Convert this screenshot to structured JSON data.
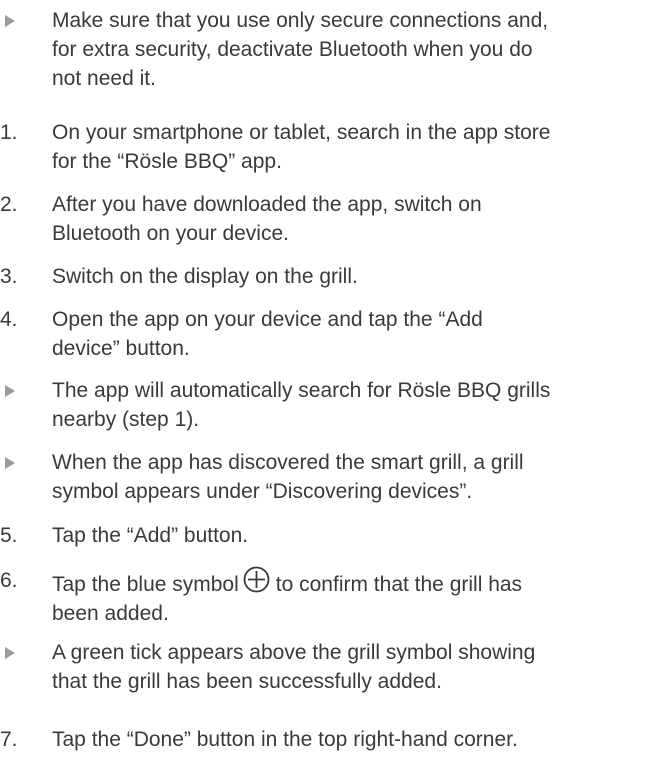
{
  "items": [
    {
      "marker": "bullet",
      "lines": [
        "Make sure that you use only secure connections and,",
        "for extra security, deactivate Bluetooth when you do",
        "not need it."
      ]
    },
    {
      "marker": "1.",
      "lines": [
        "On your smartphone or tablet, search in the app store",
        "for the “Rösle BBQ” app."
      ]
    },
    {
      "marker": "2.",
      "lines": [
        "After you have downloaded the app, switch on",
        "Bluetooth on your device."
      ]
    },
    {
      "marker": "3.",
      "lines": [
        "Switch on the display on the grill."
      ]
    },
    {
      "marker": "4.",
      "lines": [
        "Open the app on your device and tap the “Add",
        "device” button."
      ]
    },
    {
      "marker": "bullet",
      "lines": [
        "The app will automatically search for Rösle BBQ grills",
        "nearby (step 1)."
      ]
    },
    {
      "marker": "bullet",
      "lines": [
        "When the app has discovered the smart grill, a grill",
        "symbol appears under “Discovering devices”."
      ]
    },
    {
      "marker": "5.",
      "lines": [
        "Tap the “Add” button."
      ]
    },
    {
      "marker": "6.",
      "line1_before": "Tap the blue symbol",
      "line1_after": "to confirm that the grill has",
      "icon": "circle-plus-icon",
      "icon_color": "#3a3a3a",
      "lines": [
        "been added."
      ]
    },
    {
      "marker": "bullet",
      "lines": [
        "A green tick appears above the grill symbol showing",
        "that the grill has been successfully added."
      ]
    },
    {
      "marker": "7.",
      "lines": [
        "Tap the “Done” button in the top right-hand corner."
      ]
    }
  ],
  "colors": {
    "text": "#3a3a3a",
    "bullet": "#9a9a9a"
  }
}
